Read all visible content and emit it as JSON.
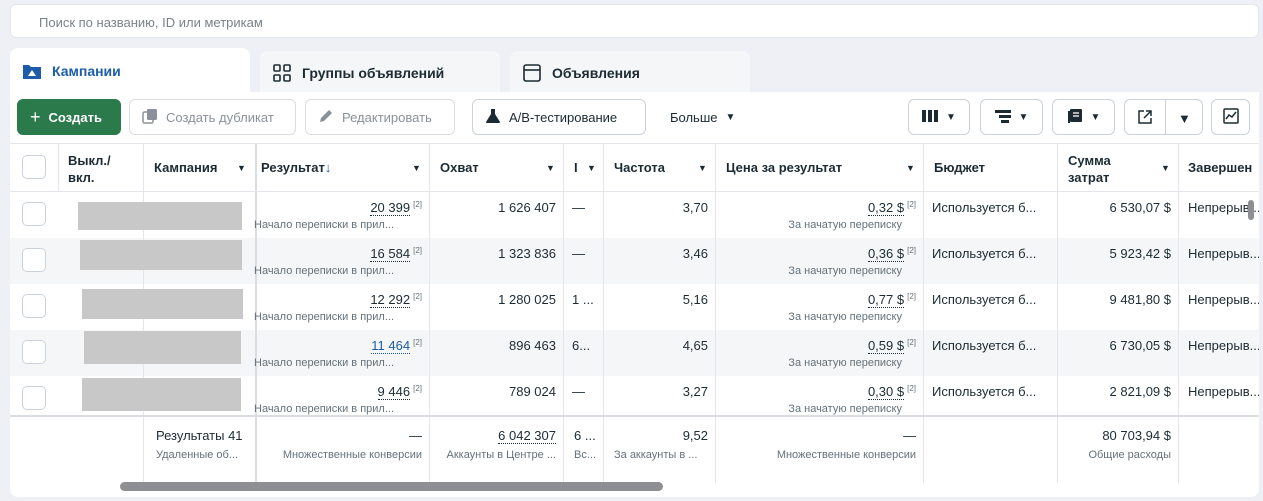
{
  "search": {
    "placeholder": "Поиск по названию, ID или метрикам"
  },
  "tabs": [
    {
      "label": "Кампании",
      "icon": "folder-icon",
      "active": true
    },
    {
      "label": "Группы объявлений",
      "icon": "grid-icon",
      "active": false
    },
    {
      "label": "Объявления",
      "icon": "ad-window-icon",
      "active": false
    }
  ],
  "toolbar": {
    "create": "Создать",
    "duplicate": "Создать дубликат",
    "edit": "Редактировать",
    "ab_test": "A/B-тестирование",
    "more": "Больше"
  },
  "columns": {
    "toggle": "Выкл./ вкл.",
    "toggle_1": "Выкл./",
    "toggle_2": "вкл.",
    "campaign": "Кампания",
    "result": "Результат",
    "reach": "Охват",
    "impressions_short": "I",
    "frequency": "Частота",
    "cost_per_result": "Цена за результат",
    "budget": "Бюджет",
    "spend_1": "Сумма",
    "spend_2": "затрат",
    "end": "Завершен"
  },
  "rows": [
    {
      "result": "20 399",
      "result_note": "[2]",
      "result_sub": "Начало переписки в прил...",
      "reach": "1 626 407",
      "impr": "—",
      "freq": "3,70",
      "cpr": "0,32 $",
      "cpr_note": "[2]",
      "cpr_sub": "За начатую переписку",
      "budget": "Используется б...",
      "spend": "6 530,07 $",
      "end": "Непрерыв..."
    },
    {
      "result": "16 584",
      "result_note": "[2]",
      "result_sub": "Начало переписки в прил...",
      "reach": "1 323 836",
      "impr": "—",
      "freq": "3,46",
      "cpr": "0,36 $",
      "cpr_note": "[2]",
      "cpr_sub": "За начатую переписку",
      "budget": "Используется б...",
      "spend": "5 923,42 $",
      "end": "Непрерыв..."
    },
    {
      "result": "12 292",
      "result_note": "[2]",
      "result_sub": "Начало переписки в прил...",
      "reach": "1 280 025",
      "impr": "1 ...",
      "freq": "5,16",
      "cpr": "0,77 $",
      "cpr_note": "[2]",
      "cpr_sub": "За начатую переписку",
      "budget": "Используется б...",
      "spend": "9 481,80 $",
      "end": "Непрерыв..."
    },
    {
      "result": "11 464",
      "result_note": "[2]",
      "result_sub": "Начало переписки в прил...",
      "reach": "896 463",
      "impr": "6...",
      "freq": "4,65",
      "cpr": "0,59 $",
      "cpr_note": "[2]",
      "cpr_sub": "За начатую переписку",
      "budget": "Используется б...",
      "spend": "6 730,05 $",
      "end": "Непрерыв..."
    },
    {
      "result": "9 446",
      "result_note": "[2]",
      "result_sub": "Начало переписки в прил...",
      "reach": "789 024",
      "impr": "—",
      "freq": "3,27",
      "cpr": "0,30 $",
      "cpr_note": "[2]",
      "cpr_sub": "За начатую переписку",
      "budget": "Используется б...",
      "spend": "2 821,09 $",
      "end": "Непрерыв..."
    }
  ],
  "totals": {
    "campaign": "Результаты 41",
    "campaign_sub": "Удаленные об...",
    "result": "—",
    "result_sub": "Множественные конверсии",
    "reach": "6 042 307",
    "reach_sub": "Аккаунты в Центре ...",
    "impr": "6 ...",
    "impr_sub": "Вс...",
    "freq": "9,52",
    "freq_sub": "За аккаунты в ...",
    "cpr": "—",
    "cpr_sub": "Множественные конверсии",
    "spend": "80 703,94 $",
    "spend_sub": "Общие расходы"
  },
  "colors": {
    "accent_blue": "#1d5ca8",
    "create_green": "#2b7a4b"
  }
}
